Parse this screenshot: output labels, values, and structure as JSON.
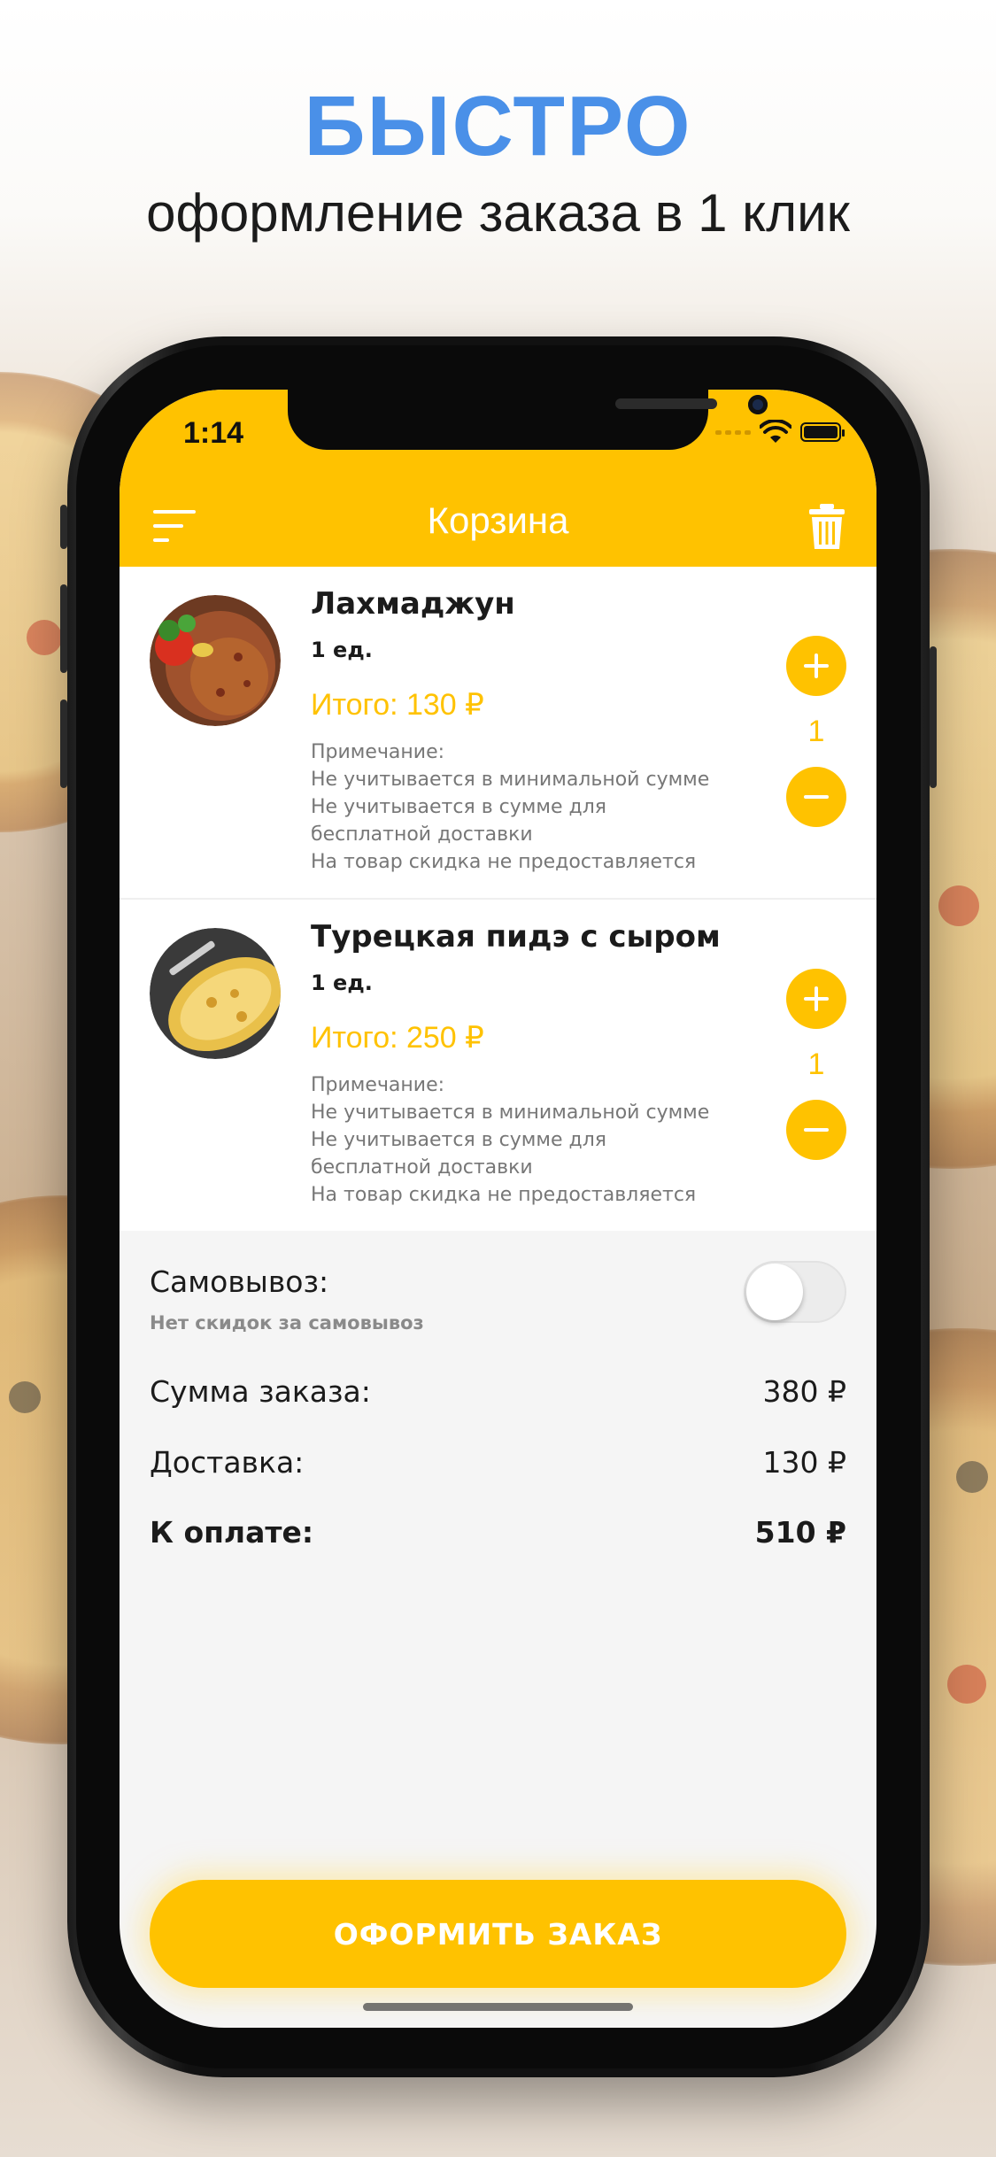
{
  "promo": {
    "headline": "БЫСТРО",
    "subheadline": "оформление заказа в 1 клик",
    "headline_color": "#4a90e8"
  },
  "status_bar": {
    "time": "1:14",
    "icons": [
      "signal-icon",
      "wifi-icon",
      "battery-icon"
    ]
  },
  "header": {
    "title": "Корзина",
    "left_icon": "menu-icon",
    "right_icon": "trash-icon"
  },
  "cart": {
    "items": [
      {
        "name": "Лахмаджун",
        "quantity_unit": "1 ед.",
        "total": "Итого: 130 ₽",
        "note_title": "Примечание:",
        "note_lines": [
          "Не учитывается в минимальной сумме",
          "Не учитывается в сумме для",
          "бесплатной доставки",
          "На товар скидка не предоставляется"
        ],
        "count": "1"
      },
      {
        "name": "Турецкая пидэ с сыром",
        "quantity_unit": "1 ед.",
        "total": "Итого: 250 ₽",
        "note_title": "Примечание:",
        "note_lines": [
          "Не учитывается в минимальной сумме",
          "Не учитывается в сумме для",
          "бесплатной доставки",
          "На товар скидка не предоставляется"
        ],
        "count": "1"
      }
    ]
  },
  "summary": {
    "pickup_label": "Самовывоз:",
    "pickup_sub": "Нет скидок за самовывоз",
    "pickup_enabled": false,
    "order_sum_label": "Сумма заказа:",
    "order_sum_value": "380 ₽",
    "delivery_label": "Доставка:",
    "delivery_value": "130 ₽",
    "to_pay_label": "К оплате:",
    "to_pay_value": "510 ₽"
  },
  "checkout_label": "ОФОРМИТЬ ЗАКАЗ",
  "colors": {
    "accent": "#ffc200",
    "note_text": "#777777",
    "screen_bg": "#f5f5f5"
  }
}
